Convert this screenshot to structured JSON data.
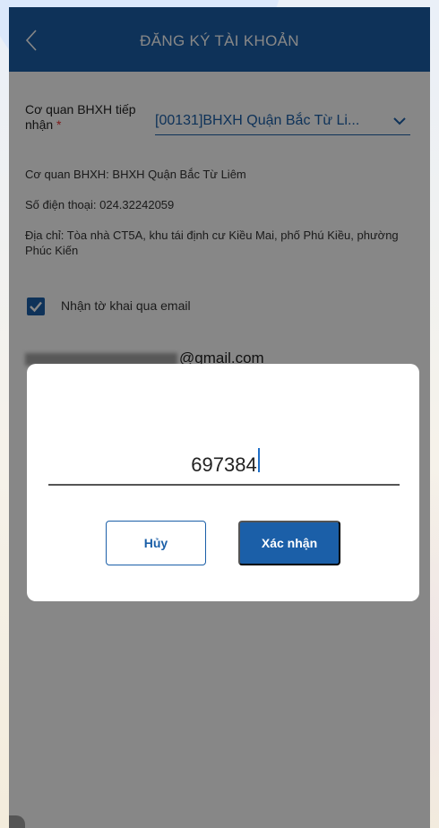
{
  "header": {
    "title": "ĐĂNG KÝ TÀI KHOẢN"
  },
  "form": {
    "agency_label": "Cơ quan BHXH tiếp nhận",
    "required_mark": "*",
    "agency_select_value": "[00131]BHXH Quận Bắc Từ Li...",
    "agency_info": "Cơ quan BHXH: BHXH Quận Bắc Từ Liêm",
    "phone_info": "Số điện thoại: 024.32242059",
    "address_info": "Địa chỉ: Tòa nhà CT5A, khu tái định cư Kiều Mai, phố Phú Kiều, phường Phúc Kiến",
    "email_checkbox_label": "Nhận tờ khai qua email",
    "email_checked": true,
    "email_visible_part": "@gmail.com"
  },
  "dialog": {
    "code_value": "697384",
    "cancel_label": "Hủy",
    "confirm_label": "Xác nhận"
  },
  "colors": {
    "primary": "#1b5fa8",
    "overlay": "rgba(0,0,0,0.47)"
  }
}
